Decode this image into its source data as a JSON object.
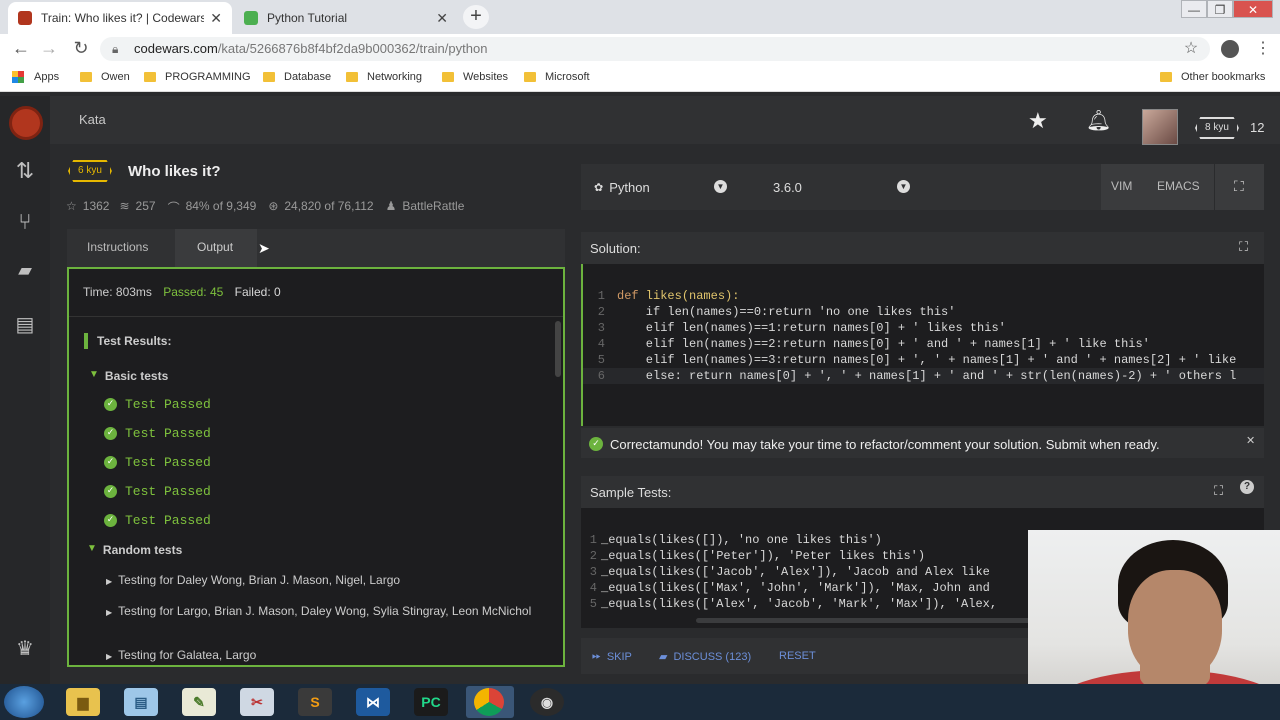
{
  "browser": {
    "tabs": [
      {
        "title": "Train: Who likes it? | Codewars",
        "active": true
      },
      {
        "title": "Python Tutorial",
        "active": false
      }
    ],
    "url_host": "codewars.com",
    "url_path": "/kata/5266876b8f4bf2da9b000362/train/python",
    "bookmarks": [
      "Apps",
      "Owen",
      "PROGRAMMING",
      "Database",
      "Networking",
      "Websites",
      "Microsoft"
    ],
    "other_bookmarks": "Other bookmarks"
  },
  "header": {
    "section": "Kata",
    "rank_badge": "8 kyu",
    "honor": "12"
  },
  "kata": {
    "kyu": "6 kyu",
    "title": "Who likes it?",
    "stars": "1362",
    "collections": "257",
    "satisfaction": "84% of 9,349",
    "completed": "24,820 of 76,112",
    "author": "BattleRattle"
  },
  "left_tabs": {
    "instructions": "Instructions",
    "output": "Output"
  },
  "output": {
    "time": "Time: 803ms",
    "passed": "Passed: 45",
    "failed": "Failed: 0",
    "results_title": "Test Results:",
    "basic_group": "Basic tests",
    "test_passed": [
      "Test Passed",
      "Test Passed",
      "Test Passed",
      "Test Passed",
      "Test Passed"
    ],
    "random_group": "Random tests",
    "random_items": [
      "Testing for Daley Wong, Brian J. Mason, Nigel, Largo",
      "Testing for Largo, Brian J. Mason, Daley Wong, Sylia Stingray, Leon McNichol",
      "Testing for Galatea, Largo"
    ]
  },
  "editor": {
    "language": "Python",
    "version": "3.6.0",
    "vim": "VIM",
    "emacs": "EMACS",
    "solution_label": "Solution:",
    "solution_lines": [
      "def likes(names):",
      "    if len(names)==0:return 'no one likes this'",
      "    elif len(names)==1:return names[0] + ' likes this'",
      "    elif len(names)==2:return names[0] + ' and ' + names[1] + ' like this'",
      "    elif len(names)==3:return names[0] + ', ' + names[1] + ' and ' + names[2] + ' like",
      "    else: return names[0] + ', ' + names[1] + ' and ' + str(len(names)-2) + ' others l"
    ],
    "success_message": "Correctamundo! You may take your time to refactor/comment your solution. Submit when ready.",
    "sample_label": "Sample Tests:",
    "sample_lines": [
      "_equals(likes([]), 'no one likes this')",
      "_equals(likes(['Peter']), 'Peter likes this')",
      "_equals(likes(['Jacob', 'Alex']), 'Jacob and Alex like",
      "_equals(likes(['Max', 'John', 'Mark']), 'Max, John and",
      "_equals(likes(['Alex', 'Jacob', 'Mark', 'Max']), 'Alex,"
    ],
    "skip": "SKIP",
    "discuss": "DISCUSS (123)",
    "reset": "RESET"
  },
  "colors": {
    "accent": "#b1361e",
    "kyu": "#e6b800",
    "pass": "#6cb33e"
  }
}
